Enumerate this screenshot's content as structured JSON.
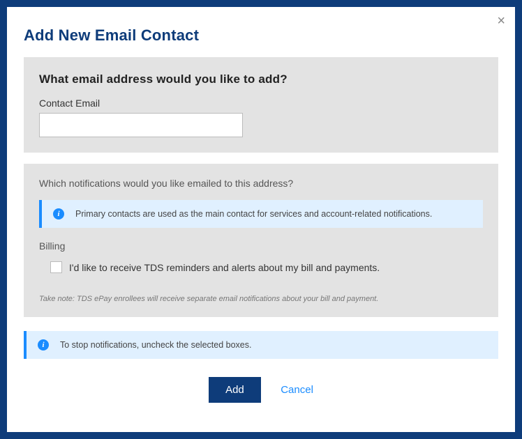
{
  "modal": {
    "title": "Add New Email Contact",
    "close": "×"
  },
  "email_section": {
    "heading": "What email address would you like to add?",
    "label": "Contact Email",
    "value": ""
  },
  "notifications": {
    "question": "Which notifications would you like emailed to this address?",
    "primary_info": "Primary contacts are used as the main contact for services and account-related notifications.",
    "billing_label": "Billing",
    "billing_checkbox_label": "I'd like to receive TDS reminders and alerts about my bill and payments.",
    "footnote": "Take note: TDS ePay enrollees will receive separate email notifications about your bill and payment."
  },
  "stop_info": "To stop notifications, uncheck the selected boxes.",
  "buttons": {
    "add": "Add",
    "cancel": "Cancel"
  },
  "info_glyph": "i"
}
